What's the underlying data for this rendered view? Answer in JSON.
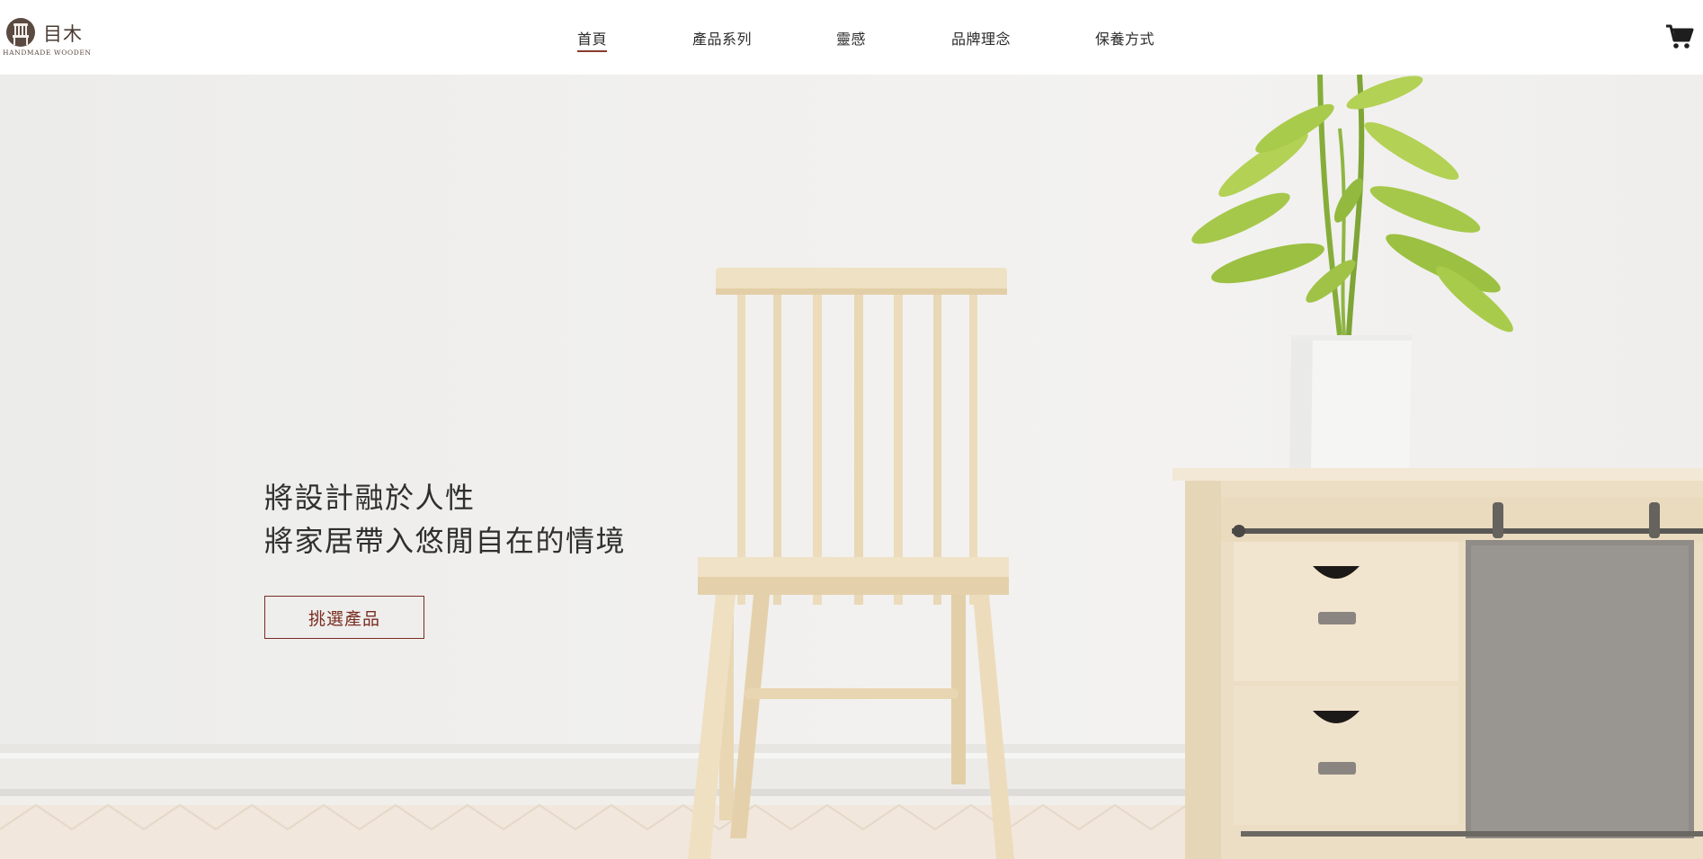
{
  "brand": {
    "name": "目木",
    "tagline": "HANDMADE WOODEN",
    "logo_icon": "wooden-chair-logo-icon",
    "accent_color": "#8b3a2b"
  },
  "nav": {
    "items": [
      {
        "label": "首頁",
        "active": true
      },
      {
        "label": "產品系列",
        "active": false
      },
      {
        "label": "靈感",
        "active": false
      },
      {
        "label": "品牌理念",
        "active": false
      },
      {
        "label": "保養方式",
        "active": false
      }
    ]
  },
  "cart": {
    "icon": "shopping-cart-icon"
  },
  "hero": {
    "line1": "將設計融於人性",
    "line2": "將家居帶入悠閒自在的情境",
    "cta_label": "挑選產品",
    "cta_color": "#7a2d22",
    "image_subjects": [
      "wooden-chair",
      "potted-plant",
      "wooden-sideboard"
    ]
  }
}
